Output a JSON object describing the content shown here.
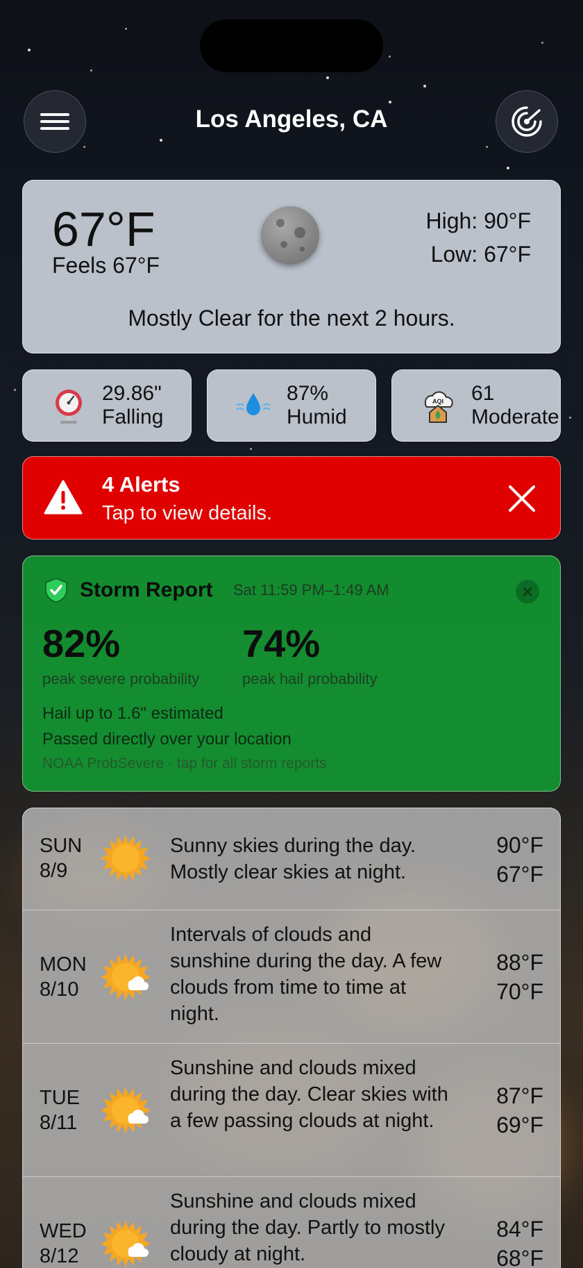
{
  "header": {
    "city": "Los Angeles, CA"
  },
  "current": {
    "temp": "67°F",
    "feels": "Feels 67°F",
    "high": "High: 90°F",
    "low": "Low: 67°F",
    "summary": "Mostly Clear for the next 2 hours."
  },
  "metrics": [
    {
      "icon": "barometer-icon",
      "value": "29.86\"",
      "label": "Falling"
    },
    {
      "icon": "humidity-icon",
      "value": "87%",
      "label": "Humid"
    },
    {
      "icon": "aqi-icon",
      "icon_text": "AQI",
      "value": "61",
      "label": "Moderate"
    }
  ],
  "alert": {
    "title": "4 Alerts",
    "subtitle": "Tap to view details.",
    "color": "#e00000"
  },
  "storm": {
    "title": "Storm Report",
    "time": "Sat 11:59 PM–1:49 AM",
    "severe_value": "82%",
    "severe_label": "peak severe probability",
    "hail_value": "74%",
    "hail_label": "peak hail probability",
    "line1": "Hail up to 1.6\" estimated",
    "line2": "Passed directly over your location",
    "footer": "NOAA ProbSevere · tap for all storm reports",
    "color": "#149632"
  },
  "forecast": [
    {
      "dow": "SUN",
      "date": "8/9",
      "icon": "sun-icon",
      "desc": "Sunny skies during the day. Mostly clear skies at night.",
      "high": "90°F",
      "low": "67°F"
    },
    {
      "dow": "MON",
      "date": "8/10",
      "icon": "sun-cloud-icon",
      "desc": "Intervals of clouds and sunshine during the day. A few clouds from time to time at night.",
      "high": "88°F",
      "low": "70°F"
    },
    {
      "dow": "TUE",
      "date": "8/11",
      "icon": "sun-cloud-icon",
      "desc": "Sunshine and clouds mixed during the day. Clear skies with a few passing clouds at night.",
      "high": "87°F",
      "low": "69°F"
    },
    {
      "dow": "WED",
      "date": "8/12",
      "icon": "sun-cloud-icon",
      "desc": "Sunshine and clouds mixed during the day. Partly to mostly cloudy at night.",
      "high": "84°F",
      "low": "68°F"
    }
  ]
}
